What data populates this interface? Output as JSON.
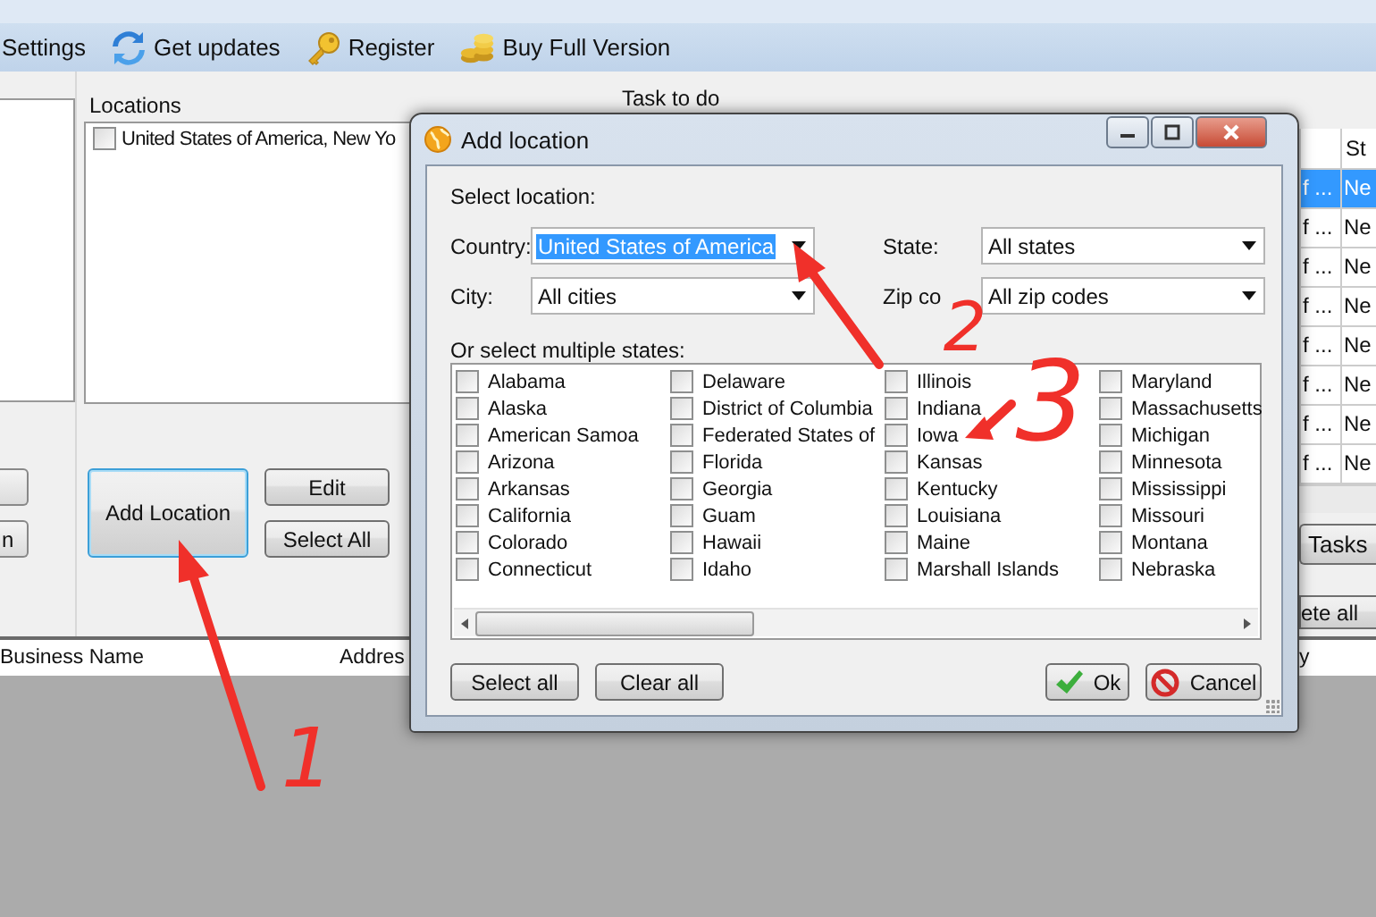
{
  "toolbar": [
    {
      "label": "Settings"
    },
    {
      "label": "Get updates"
    },
    {
      "label": "Register"
    },
    {
      "label": "Buy Full Version"
    }
  ],
  "left_panel": {
    "button_label": "n"
  },
  "locations": {
    "title": "Locations",
    "items": [
      {
        "label": "United States of America, New Yo",
        "checked": false
      }
    ],
    "buttons": [
      {
        "label": "Add Location",
        "focused": true
      },
      {
        "label": "Edit",
        "focused": false
      },
      {
        "label": "Select All",
        "focused": false
      }
    ]
  },
  "tasks": {
    "title": "Task to do",
    "column_header": "St",
    "rows": [
      {
        "column_1": "f ...",
        "column_2": "Ne",
        "selected": true
      },
      {
        "column_1": "f ...",
        "column_2": "Ne",
        "selected": false
      },
      {
        "column_1": "f ...",
        "column_2": "Ne",
        "selected": false
      },
      {
        "column_1": "f ...",
        "column_2": "Ne",
        "selected": false
      },
      {
        "column_1": "f ...",
        "column_2": "Ne",
        "selected": false
      },
      {
        "column_1": "f ...",
        "column_2": "Ne",
        "selected": false
      },
      {
        "column_1": "f ...",
        "column_2": "Ne",
        "selected": false
      },
      {
        "column_1": "f ...",
        "column_2": "Ne",
        "selected": false
      }
    ],
    "buttons": [
      "Tasks",
      "ete all"
    ]
  },
  "results_table": {
    "columns": [
      "Business Name",
      "Addres",
      "y"
    ]
  },
  "dialog": {
    "title": "Add location",
    "section_label": "Select location:",
    "fields": [
      {
        "label": "Country:",
        "value": "United States of America",
        "highlighted": true
      },
      {
        "label": "State:",
        "value": "All states",
        "highlighted": false
      },
      {
        "label": "City:",
        "value": "All cities",
        "highlighted": false
      },
      {
        "label": "Zip co",
        "value": "All zip codes",
        "highlighted": false
      }
    ],
    "states_label": "Or select multiple states:",
    "states": [
      {
        "label": "Alabama",
        "checked": false
      },
      {
        "label": "Alaska",
        "checked": false
      },
      {
        "label": "American Samoa",
        "checked": false
      },
      {
        "label": "Arizona",
        "checked": false
      },
      {
        "label": "Arkansas",
        "checked": false
      },
      {
        "label": "California",
        "checked": false
      },
      {
        "label": "Colorado",
        "checked": false
      },
      {
        "label": "Connecticut",
        "checked": false
      },
      {
        "label": "Delaware",
        "checked": false
      },
      {
        "label": "District of Columbia",
        "checked": false
      },
      {
        "label": "Federated States of",
        "checked": false
      },
      {
        "label": "Florida",
        "checked": false
      },
      {
        "label": "Georgia",
        "checked": false
      },
      {
        "label": "Guam",
        "checked": false
      },
      {
        "label": "Hawaii",
        "checked": false
      },
      {
        "label": "Idaho",
        "checked": false
      },
      {
        "label": "Illinois",
        "checked": false
      },
      {
        "label": "Indiana",
        "checked": false
      },
      {
        "label": "Iowa",
        "checked": false
      },
      {
        "label": "Kansas",
        "checked": false
      },
      {
        "label": "Kentucky",
        "checked": false
      },
      {
        "label": "Louisiana",
        "checked": false
      },
      {
        "label": "Maine",
        "checked": false
      },
      {
        "label": "Marshall Islands",
        "checked": false
      },
      {
        "label": "Maryland",
        "checked": false
      },
      {
        "label": "Massachusetts",
        "checked": false
      },
      {
        "label": "Michigan",
        "checked": false
      },
      {
        "label": "Minnesota",
        "checked": false
      },
      {
        "label": "Mississippi",
        "checked": false
      },
      {
        "label": "Missouri",
        "checked": false
      },
      {
        "label": "Montana",
        "checked": false
      },
      {
        "label": "Nebraska",
        "checked": false
      }
    ],
    "buttons": [
      "Select all",
      "Clear all",
      "Ok",
      "Cancel"
    ]
  },
  "annotations": [
    {
      "label": "1"
    },
    {
      "label": "2"
    },
    {
      "label": "3"
    }
  ]
}
